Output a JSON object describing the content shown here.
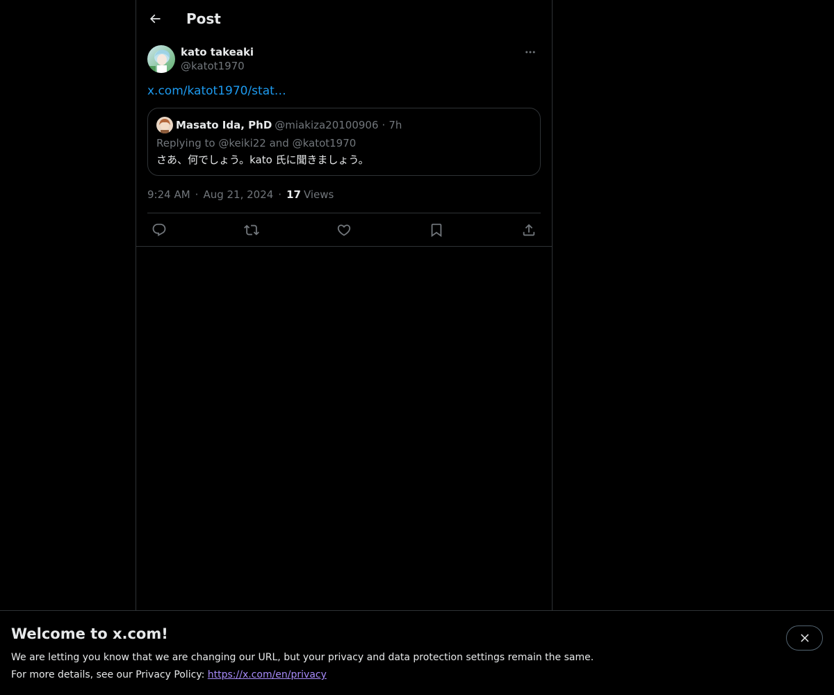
{
  "header": {
    "title": "Post",
    "back_icon": "arrow-left-icon"
  },
  "post": {
    "author": {
      "display_name": "kato takeaki",
      "handle": "@katot1970"
    },
    "link_text": "x.com/katot1970/stat…",
    "quoted": {
      "display_name": "Masato Ida, PhD",
      "handle": "@miakiza20100906",
      "separator": "·",
      "time": "7h",
      "replying_to": "Replying to @keiki22 and @katot1970",
      "body": "さあ、何でしょう。kato 氏に聞きましょう。"
    },
    "meta": {
      "time": "9:24 AM",
      "separator": "·",
      "date": "Aug 21, 2024",
      "views_count": "17",
      "views_label": "Views"
    },
    "actions": [
      "reply-icon",
      "repost-icon",
      "like-icon",
      "bookmark-icon",
      "share-icon"
    ]
  },
  "banner": {
    "title": "Welcome to x.com!",
    "line1": "We are letting you know that we are changing our URL, but your privacy and data protection settings remain the same.",
    "line2_prefix": "For more details, see our Privacy Policy: ",
    "privacy_link": "https://x.com/en/privacy"
  },
  "colors": {
    "background": "#000000",
    "text_primary": "#e7e9ea",
    "text_secondary": "#71767b",
    "link": "#1d9bf0",
    "border": "#2f3336",
    "visited_link": "#a78bfa"
  }
}
